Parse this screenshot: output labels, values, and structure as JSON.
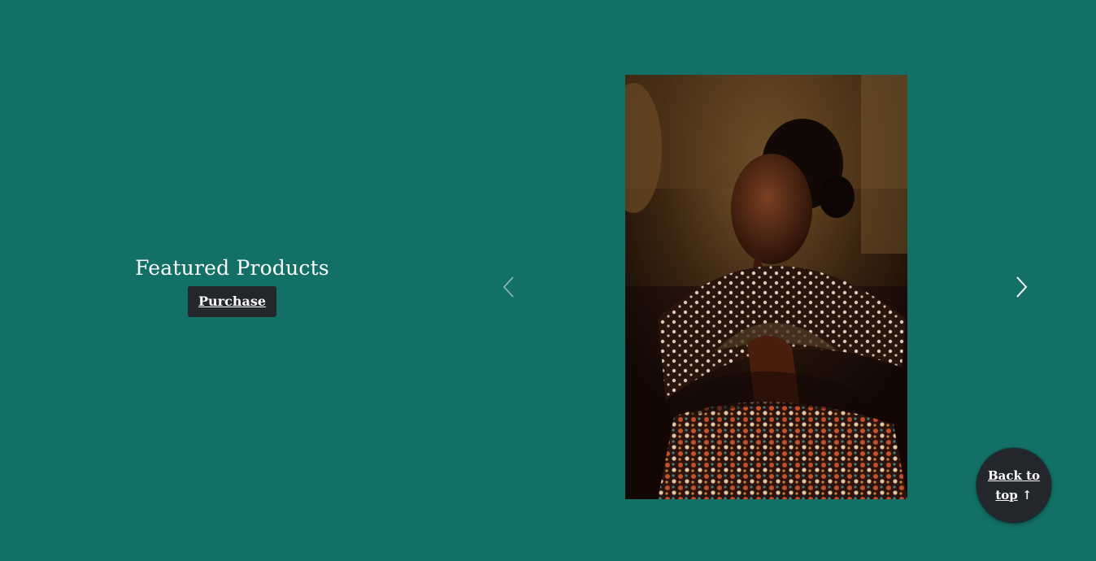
{
  "colors": {
    "background": "#137066",
    "button": "#23262a",
    "text": "#ffffff"
  },
  "feature": {
    "title": "Featured Products",
    "purchase_label": "Purchase"
  },
  "carousel": {
    "prev_icon": "chevron-left-icon",
    "next_icon": "chevron-right-icon",
    "image_icon": "portrait-photo-woman-with-fan"
  },
  "back_to_top": {
    "label_line1": "Back to",
    "label_line2": "top",
    "arrow": "↑"
  }
}
